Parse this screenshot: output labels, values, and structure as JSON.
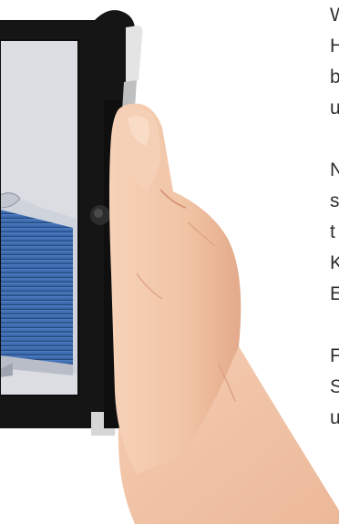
{
  "photo": {
    "subject": "hand-holding-tablet-case",
    "colors": {
      "case": "#151515",
      "case_edge": "#2a2a2a",
      "screen_bg": "#dcdde3",
      "screen_model": "#3a66a8",
      "skin": "#f2c7a9",
      "skin_shadow": "#e3a989",
      "clip": "#e4e4e4"
    }
  },
  "edge_text": {
    "lines": [
      "W",
      "H",
      "b",
      "u",
      "",
      "N",
      "s",
      "t",
      "K",
      "E",
      "",
      "F",
      "S",
      "u"
    ]
  }
}
